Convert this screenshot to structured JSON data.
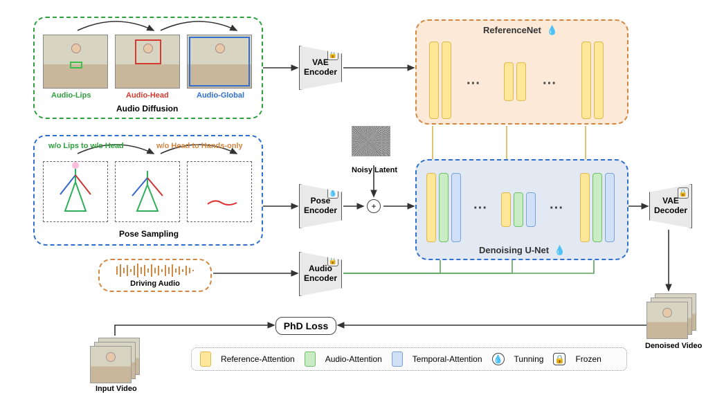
{
  "audio_diffusion": {
    "lips": "Audio-Lips",
    "head": "Audio-Head",
    "global": "Audio-Global",
    "title": "Audio Diffusion"
  },
  "pose_sampling": {
    "left": "w/o Lips to w/o Head",
    "right": "w/o Head to Hands-only",
    "title": "Pose Sampling"
  },
  "driving_audio": "Driving Audio",
  "input_video": "Input Video",
  "noisy_latent": "Noisy Latent",
  "denoised_video": "Denoised Video",
  "encoders": {
    "vae_enc": "VAE\nEncoder",
    "pose_enc": "Pose\nEncoder",
    "audio_enc": "Audio\nEncoder",
    "vae_dec": "VAE\nDecoder"
  },
  "reference_net": "ReferenceNet",
  "denoising_unet": "Denoising U-Net",
  "phd_loss": "PhD Loss",
  "legend": {
    "ref": "Reference-Attention",
    "aud": "Audio-Attention",
    "tmp": "Temporal-Attention",
    "tune": "Tunning",
    "froz": "Frozen"
  },
  "icons": {
    "tuning": "💧",
    "frozen": "🔒",
    "plus": "+"
  }
}
